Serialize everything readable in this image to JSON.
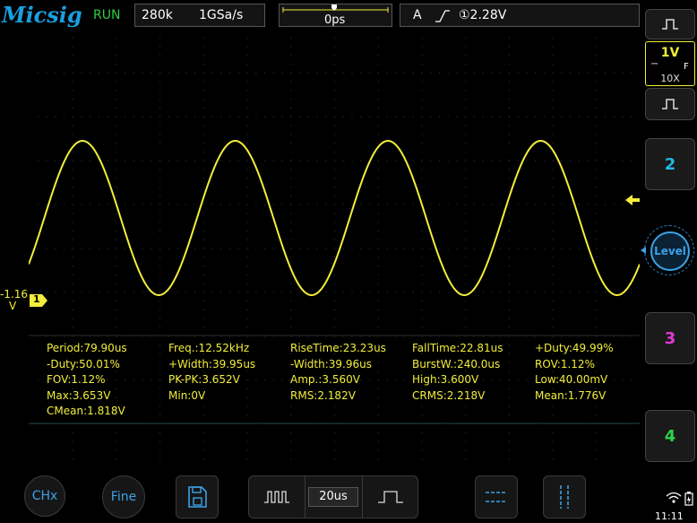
{
  "header": {
    "brand": "Micsig",
    "run_state": "RUN",
    "memory_depth": "280k",
    "sample_rate": "1GSa/s",
    "time_offset": "0ps",
    "trigger_mode": "A",
    "trigger_level": "①2.28V"
  },
  "channel": {
    "marker": "1",
    "offset_line1": "-1.16",
    "offset_line2": "V",
    "scale": "1V",
    "coupling": "F",
    "probe": "10X"
  },
  "right_panel": {
    "ch2_label": "2",
    "level_label": "Level",
    "ch3_label": "3",
    "ch4_label": "4",
    "ch2_color": "#20b8e0",
    "ch3_color": "#e03ad8",
    "ch4_color": "#2ed34a"
  },
  "measurements": [
    [
      "Period:79.90us",
      "Freq.:12.52kHz",
      "RiseTime:23.23us",
      "FallTime:22.81us",
      "+Duty:49.99%"
    ],
    [
      "-Duty:50.01%",
      "+Width:39.95us",
      "-Width:39.96us",
      "BurstW.:240.0us",
      "ROV:1.12%"
    ],
    [
      "FOV:1.12%",
      "PK-PK:3.652V",
      "Amp.:3.560V",
      "High:3.600V",
      "Low:40.00mV"
    ],
    [
      "Max:3.653V",
      "Min:0V",
      "RMS:2.182V",
      "CRMS:2.218V",
      "Mean:1.776V"
    ],
    [
      "CMean:1.818V"
    ]
  ],
  "bottom": {
    "chx_label": "CHx",
    "fine_label": "Fine",
    "timebase": "20us"
  },
  "status": {
    "clock": "11:11"
  },
  "colors": {
    "trace": "#f2ee3a",
    "accent": "#1a9fe0",
    "run": "#2ecc40"
  },
  "chart_data": {
    "type": "line",
    "series": [
      {
        "period_divs": 3.99,
        "high_v": 3.6,
        "low_v": 0.04
      }
    ],
    "cycles_visible": 4.0
  }
}
